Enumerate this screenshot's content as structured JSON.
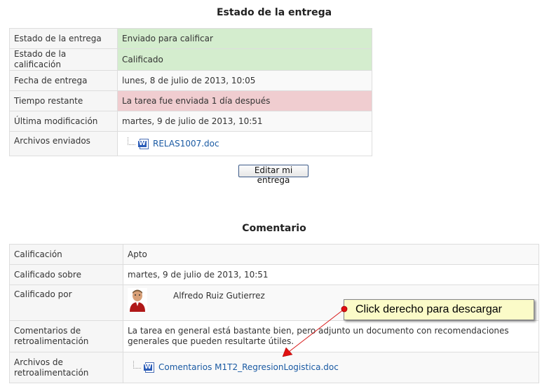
{
  "submission": {
    "heading": "Estado de la entrega",
    "rows": [
      {
        "label": "Estado de la entrega",
        "value": "Enviado para calificar"
      },
      {
        "label": "Estado de la calificación",
        "value": "Calificado"
      },
      {
        "label": "Fecha de entrega",
        "value": "lunes, 8 de julio de 2013, 10:05"
      },
      {
        "label": "Tiempo restante",
        "value": "La tarea fue enviada 1 día después"
      },
      {
        "label": "Última modificación",
        "value": "martes, 9 de julio de 2013, 10:51"
      },
      {
        "label": "Archivos enviados",
        "value": "RELAS1007.doc"
      }
    ],
    "edit_button": "Editar mi entrega",
    "colors": {
      "ok": "#d4edce",
      "late": "#f0cdd0"
    }
  },
  "feedback": {
    "heading": "Comentario",
    "rows": [
      {
        "label": "Calificación",
        "value": "Apto"
      },
      {
        "label": "Calificado sobre",
        "value": "martes, 9 de julio de 2013, 10:51"
      },
      {
        "label": "Calificado por",
        "value": "Alfredo Ruiz Gutierrez"
      },
      {
        "label": "Comentarios de retroalimentación",
        "value": "La tarea en general está bastante bien, pero adjunto un documento con recomendaciones generales que pueden resultarte útiles."
      },
      {
        "label": "Archivos de retroalimentación",
        "value": "Comentarios M1T2_RegresionLogistica.doc"
      }
    ]
  },
  "callout": {
    "text": "Click derecho para descargar"
  },
  "icons": {
    "file_icon": "word-doc-icon",
    "avatar": "user-avatar"
  }
}
